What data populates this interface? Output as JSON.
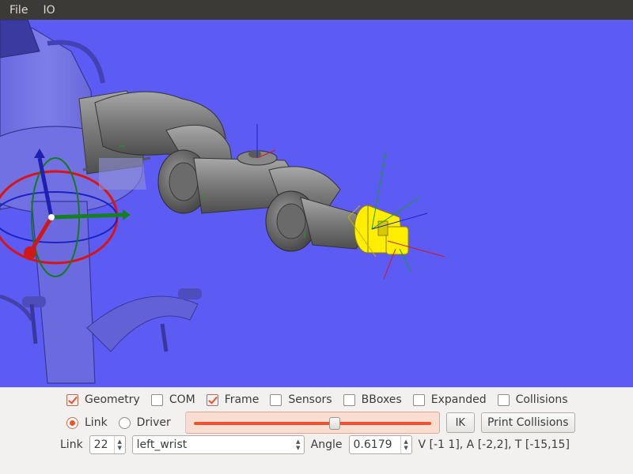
{
  "menubar": {
    "items": [
      "File",
      "IO"
    ]
  },
  "display_options": [
    {
      "label": "Geometry",
      "checked": true
    },
    {
      "label": "COM",
      "checked": false
    },
    {
      "label": "Frame",
      "checked": true
    },
    {
      "label": "Sensors",
      "checked": false
    },
    {
      "label": "BBoxes",
      "checked": false
    },
    {
      "label": "Expanded",
      "checked": false
    },
    {
      "label": "Collisions",
      "checked": false
    }
  ],
  "mode": {
    "link_label": "Link",
    "driver_label": "Driver",
    "selected": "Link"
  },
  "slider": {
    "position": 0.6
  },
  "buttons": {
    "ik": "IK",
    "print_collisions": "Print Collisions"
  },
  "link_row": {
    "link_label": "Link",
    "link_index": "22",
    "link_name": "left_wrist",
    "angle_label": "Angle",
    "angle_value": "0.6179",
    "range_text": "V [-1 1], A [-2,2], T [-15,15]"
  },
  "colors": {
    "viewport_bg": "#5c5cf5",
    "accent": "#e9542e",
    "selected_link": "#ffee00",
    "menubar_bg": "#3b3a36"
  }
}
